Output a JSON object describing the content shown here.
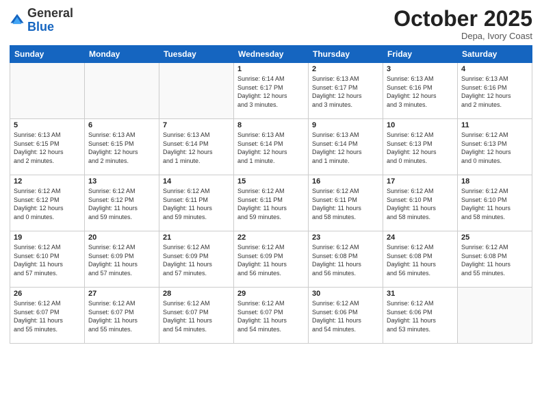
{
  "header": {
    "logo": {
      "general": "General",
      "blue": "Blue"
    },
    "title": "October 2025",
    "location": "Depa, Ivory Coast"
  },
  "weekdays": [
    "Sunday",
    "Monday",
    "Tuesday",
    "Wednesday",
    "Thursday",
    "Friday",
    "Saturday"
  ],
  "weeks": [
    [
      {
        "day": "",
        "info": ""
      },
      {
        "day": "",
        "info": ""
      },
      {
        "day": "",
        "info": ""
      },
      {
        "day": "1",
        "info": "Sunrise: 6:14 AM\nSunset: 6:17 PM\nDaylight: 12 hours\nand 3 minutes."
      },
      {
        "day": "2",
        "info": "Sunrise: 6:13 AM\nSunset: 6:17 PM\nDaylight: 12 hours\nand 3 minutes."
      },
      {
        "day": "3",
        "info": "Sunrise: 6:13 AM\nSunset: 6:16 PM\nDaylight: 12 hours\nand 3 minutes."
      },
      {
        "day": "4",
        "info": "Sunrise: 6:13 AM\nSunset: 6:16 PM\nDaylight: 12 hours\nand 2 minutes."
      }
    ],
    [
      {
        "day": "5",
        "info": "Sunrise: 6:13 AM\nSunset: 6:15 PM\nDaylight: 12 hours\nand 2 minutes."
      },
      {
        "day": "6",
        "info": "Sunrise: 6:13 AM\nSunset: 6:15 PM\nDaylight: 12 hours\nand 2 minutes."
      },
      {
        "day": "7",
        "info": "Sunrise: 6:13 AM\nSunset: 6:14 PM\nDaylight: 12 hours\nand 1 minute."
      },
      {
        "day": "8",
        "info": "Sunrise: 6:13 AM\nSunset: 6:14 PM\nDaylight: 12 hours\nand 1 minute."
      },
      {
        "day": "9",
        "info": "Sunrise: 6:13 AM\nSunset: 6:14 PM\nDaylight: 12 hours\nand 1 minute."
      },
      {
        "day": "10",
        "info": "Sunrise: 6:12 AM\nSunset: 6:13 PM\nDaylight: 12 hours\nand 0 minutes."
      },
      {
        "day": "11",
        "info": "Sunrise: 6:12 AM\nSunset: 6:13 PM\nDaylight: 12 hours\nand 0 minutes."
      }
    ],
    [
      {
        "day": "12",
        "info": "Sunrise: 6:12 AM\nSunset: 6:12 PM\nDaylight: 12 hours\nand 0 minutes."
      },
      {
        "day": "13",
        "info": "Sunrise: 6:12 AM\nSunset: 6:12 PM\nDaylight: 11 hours\nand 59 minutes."
      },
      {
        "day": "14",
        "info": "Sunrise: 6:12 AM\nSunset: 6:11 PM\nDaylight: 11 hours\nand 59 minutes."
      },
      {
        "day": "15",
        "info": "Sunrise: 6:12 AM\nSunset: 6:11 PM\nDaylight: 11 hours\nand 59 minutes."
      },
      {
        "day": "16",
        "info": "Sunrise: 6:12 AM\nSunset: 6:11 PM\nDaylight: 11 hours\nand 58 minutes."
      },
      {
        "day": "17",
        "info": "Sunrise: 6:12 AM\nSunset: 6:10 PM\nDaylight: 11 hours\nand 58 minutes."
      },
      {
        "day": "18",
        "info": "Sunrise: 6:12 AM\nSunset: 6:10 PM\nDaylight: 11 hours\nand 58 minutes."
      }
    ],
    [
      {
        "day": "19",
        "info": "Sunrise: 6:12 AM\nSunset: 6:10 PM\nDaylight: 11 hours\nand 57 minutes."
      },
      {
        "day": "20",
        "info": "Sunrise: 6:12 AM\nSunset: 6:09 PM\nDaylight: 11 hours\nand 57 minutes."
      },
      {
        "day": "21",
        "info": "Sunrise: 6:12 AM\nSunset: 6:09 PM\nDaylight: 11 hours\nand 57 minutes."
      },
      {
        "day": "22",
        "info": "Sunrise: 6:12 AM\nSunset: 6:09 PM\nDaylight: 11 hours\nand 56 minutes."
      },
      {
        "day": "23",
        "info": "Sunrise: 6:12 AM\nSunset: 6:08 PM\nDaylight: 11 hours\nand 56 minutes."
      },
      {
        "day": "24",
        "info": "Sunrise: 6:12 AM\nSunset: 6:08 PM\nDaylight: 11 hours\nand 56 minutes."
      },
      {
        "day": "25",
        "info": "Sunrise: 6:12 AM\nSunset: 6:08 PM\nDaylight: 11 hours\nand 55 minutes."
      }
    ],
    [
      {
        "day": "26",
        "info": "Sunrise: 6:12 AM\nSunset: 6:07 PM\nDaylight: 11 hours\nand 55 minutes."
      },
      {
        "day": "27",
        "info": "Sunrise: 6:12 AM\nSunset: 6:07 PM\nDaylight: 11 hours\nand 55 minutes."
      },
      {
        "day": "28",
        "info": "Sunrise: 6:12 AM\nSunset: 6:07 PM\nDaylight: 11 hours\nand 54 minutes."
      },
      {
        "day": "29",
        "info": "Sunrise: 6:12 AM\nSunset: 6:07 PM\nDaylight: 11 hours\nand 54 minutes."
      },
      {
        "day": "30",
        "info": "Sunrise: 6:12 AM\nSunset: 6:06 PM\nDaylight: 11 hours\nand 54 minutes."
      },
      {
        "day": "31",
        "info": "Sunrise: 6:12 AM\nSunset: 6:06 PM\nDaylight: 11 hours\nand 53 minutes."
      },
      {
        "day": "",
        "info": ""
      }
    ]
  ]
}
